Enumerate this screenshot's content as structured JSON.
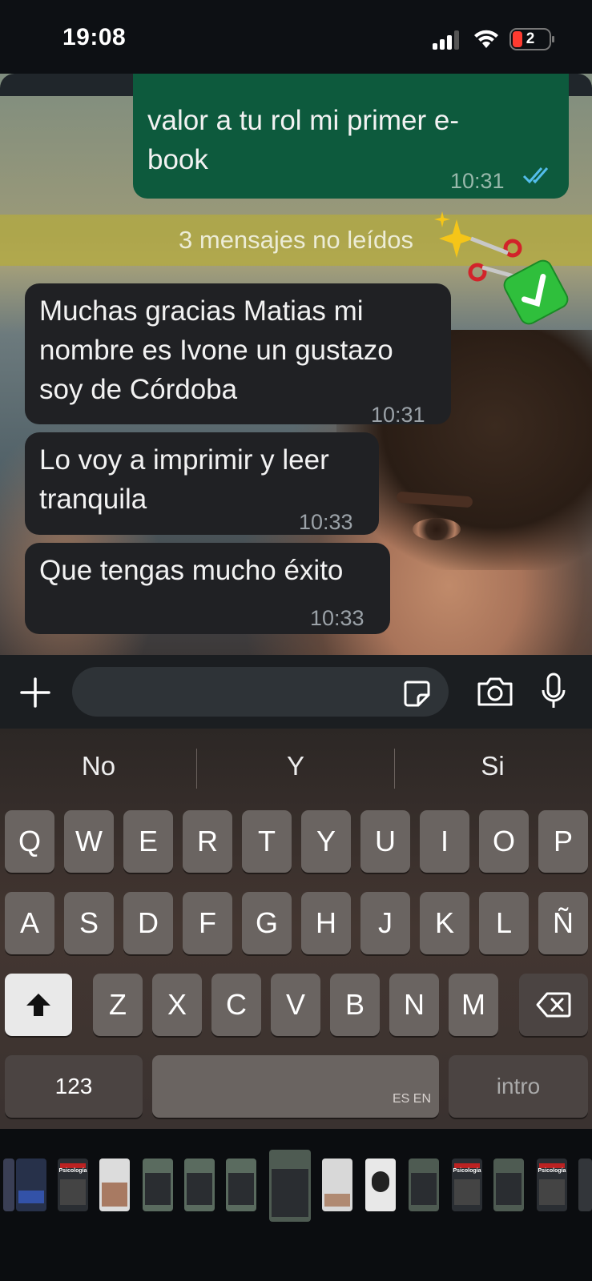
{
  "status_bar": {
    "time": "19:08",
    "battery_level": "2",
    "signal_icon": "signal-bars-icon",
    "wifi_icon": "wifi-icon"
  },
  "chat": {
    "outgoing_message": {
      "text_lines": [
        "valor a tu rol mi primer e-",
        "book"
      ],
      "time": "10:31",
      "status_icon": "double-check-icon"
    },
    "unread_banner": "3 mensajes no leídos",
    "stickers": [
      "sparkles-icon",
      "scissors-icon",
      "check-mark-button-icon"
    ],
    "incoming_messages": [
      {
        "text_lines": [
          "Muchas gracias Matias mi",
          "nombre es Ivone un gustazo",
          "soy de Córdoba"
        ],
        "time": "10:31"
      },
      {
        "text_lines": [
          "Lo voy a imprimir y leer",
          "tranquila"
        ],
        "time": "10:33"
      },
      {
        "text_lines": [
          "Que tengas mucho éxito"
        ],
        "time": "10:33"
      }
    ]
  },
  "composer": {
    "plus_icon": "plus-icon",
    "sticker_icon": "sticker-icon",
    "camera_icon": "camera-icon",
    "mic_icon": "microphone-icon",
    "input_value": ""
  },
  "keyboard": {
    "suggestions": [
      "No",
      "Y",
      "Si"
    ],
    "row1": [
      "Q",
      "W",
      "E",
      "R",
      "T",
      "Y",
      "U",
      "I",
      "O",
      "P"
    ],
    "row2": [
      "A",
      "S",
      "D",
      "F",
      "G",
      "H",
      "J",
      "K",
      "L",
      "Ñ"
    ],
    "row3": [
      "Z",
      "X",
      "C",
      "V",
      "B",
      "N",
      "M"
    ],
    "numbers_key": "123",
    "space_language_label": "ES EN",
    "return_key": "intro",
    "shift_icon": "shift-arrow-icon",
    "delete_icon": "backspace-icon"
  },
  "app_tray": {
    "thumb_labels": [
      "Psicología",
      "Psicología",
      "Psicología"
    ]
  },
  "colors": {
    "outgoing_bubble": "#0d5a3d",
    "incoming_bubble": "#202124",
    "read_ticks": "#53bdeb",
    "unread_banner": "#b4aa3c"
  }
}
